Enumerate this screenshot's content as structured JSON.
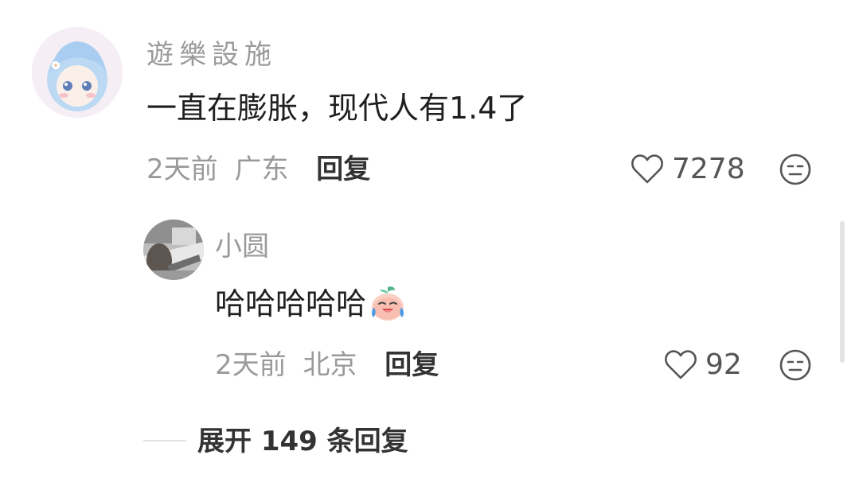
{
  "comment": {
    "username": "遊樂設施",
    "content": "一直在膨胀，现代人有1.4了",
    "time": "2天前",
    "location": "广东",
    "reply_label": "回复",
    "like_count": "7278"
  },
  "reply": {
    "username": "小圆",
    "content": "哈哈哈哈哈",
    "emoji": "laughing-peach-emoji",
    "time": "2天前",
    "location": "北京",
    "reply_label": "回复",
    "like_count": "92"
  },
  "expand_replies_label": "展开 149 条回复",
  "icons": {
    "like": "heart-outline-icon",
    "dislike": "neutral-face-icon"
  },
  "colors": {
    "secondary_text": "#9a9a9a",
    "primary_text": "#1f1f1f"
  }
}
